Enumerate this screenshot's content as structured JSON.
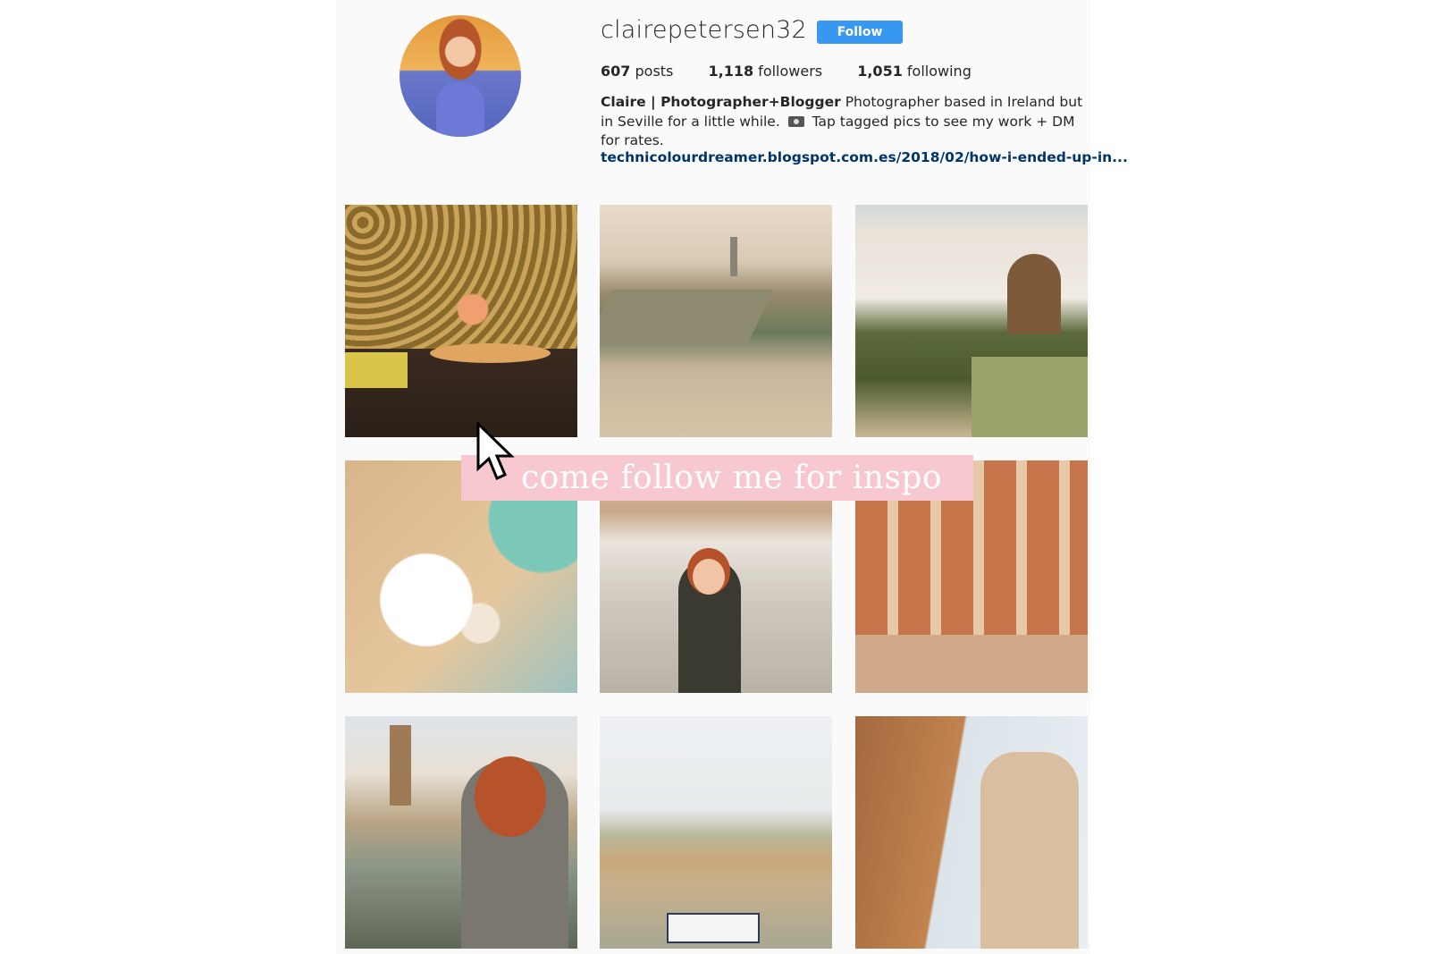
{
  "profile": {
    "username": "clairepetersen32",
    "follow_label": "Follow",
    "stats": [
      {
        "count": "607",
        "label": " posts"
      },
      {
        "count": "1,118",
        "label": " followers"
      },
      {
        "count": "1,051",
        "label": " following"
      }
    ],
    "bio_name": "Claire | Photographer+Blogger",
    "bio_text_1": " Photographer based in Ireland but in Seville for a little while. ",
    "bio_text_2": " Tap tagged pics to see my work + DM for rates.",
    "link": "technicolourdreamer.blogspot.com.es/2018/02/how-i-ended-up-in..."
  },
  "overlay": {
    "banner_text": "come follow me for inspo"
  },
  "colors": {
    "follow_button": "#3897f0",
    "link": "#003569",
    "banner": "#f8c8d0"
  },
  "icons": {
    "camera": "camera-icon",
    "cursor": "mouse-pointer-icon"
  }
}
